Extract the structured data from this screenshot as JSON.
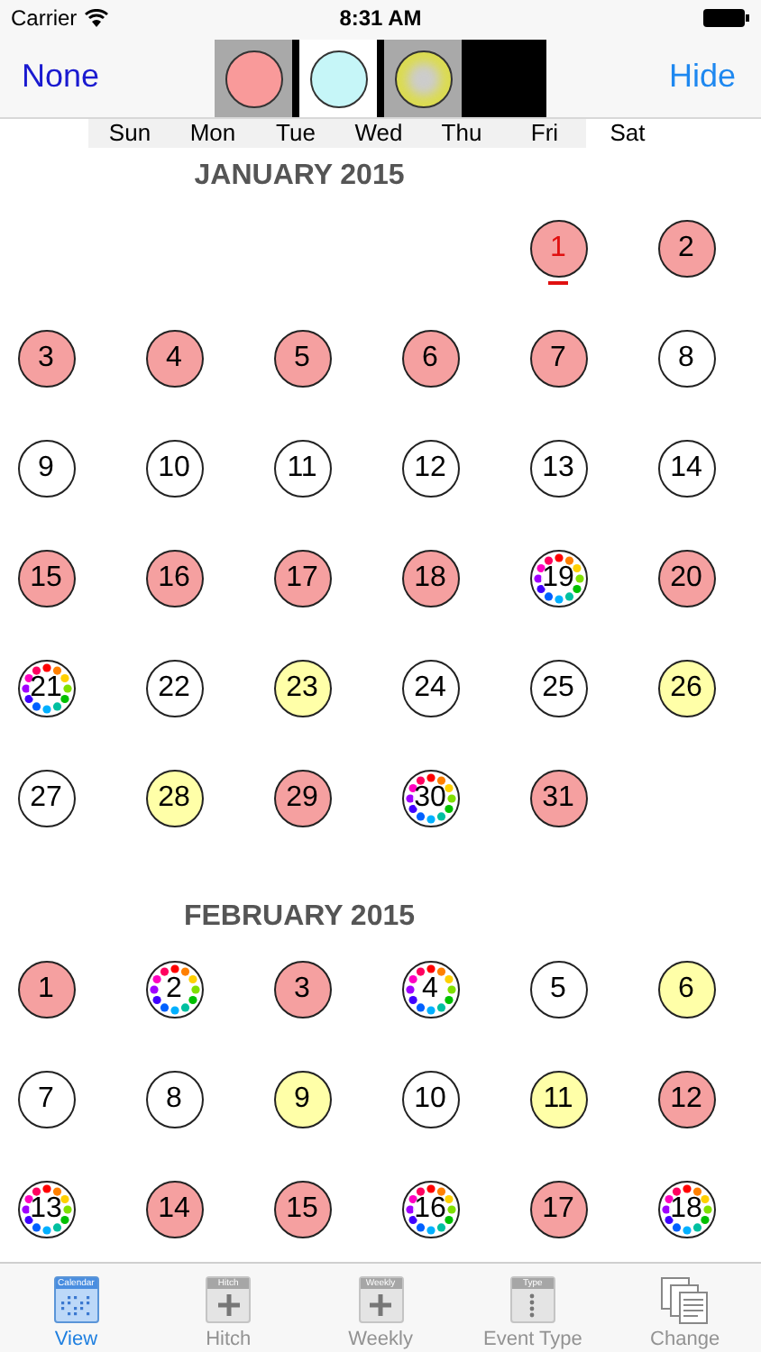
{
  "status_bar": {
    "carrier": "Carrier",
    "time": "8:31 AM"
  },
  "nav_bar": {
    "left_button": "None",
    "right_button": "Hide"
  },
  "swatches": [
    {
      "kind": "circle",
      "color": "#f99a9a",
      "selected": true
    },
    {
      "kind": "circle",
      "color": "#c6f6f8",
      "selected": false
    },
    {
      "kind": "gradient",
      "color": "#dcdc50",
      "selected": true
    },
    {
      "kind": "empty",
      "color": "#000000"
    }
  ],
  "weekdays": [
    {
      "label": "Sun",
      "shaded": true
    },
    {
      "label": "Mon",
      "shaded": true
    },
    {
      "label": "Tue",
      "shaded": true
    },
    {
      "label": "Wed",
      "shaded": true
    },
    {
      "label": "Thu",
      "shaded": true
    },
    {
      "label": "Fri",
      "shaded": true
    },
    {
      "label": "Sat",
      "shaded": false
    }
  ],
  "months": [
    {
      "title": "JANUARY 2015",
      "days": [
        {
          "label": "1",
          "kind": "filled",
          "color": "#f5a0a0",
          "today": true
        },
        {
          "label": "2",
          "kind": "filled",
          "color": "#f5a0a0",
          "today": false
        },
        {
          "label": "3",
          "kind": "filled",
          "color": "#f5a0a0",
          "today": false
        },
        {
          "label": "4",
          "kind": "filled",
          "color": "#f5a0a0",
          "today": false
        },
        {
          "label": "5",
          "kind": "filled",
          "color": "#f5a0a0",
          "today": false
        },
        {
          "label": "6",
          "kind": "filled",
          "color": "#f5a0a0",
          "today": false
        },
        {
          "label": "7",
          "kind": "filled",
          "color": "#f5a0a0",
          "today": false
        },
        {
          "label": "8",
          "kind": "plain",
          "today": false
        },
        {
          "label": "9",
          "kind": "plain",
          "today": false
        },
        {
          "label": "10",
          "kind": "plain",
          "today": false
        },
        {
          "label": "11",
          "kind": "plain",
          "today": false
        },
        {
          "label": "12",
          "kind": "plain",
          "today": false
        },
        {
          "label": "13",
          "kind": "plain",
          "today": false
        },
        {
          "label": "14",
          "kind": "plain",
          "today": false
        },
        {
          "label": "15",
          "kind": "filled",
          "color": "#f5a0a0",
          "today": false
        },
        {
          "label": "16",
          "kind": "filled",
          "color": "#f5a0a0",
          "today": false
        },
        {
          "label": "17",
          "kind": "filled",
          "color": "#f5a0a0",
          "today": false
        },
        {
          "label": "18",
          "kind": "filled",
          "color": "#f5a0a0",
          "today": false
        },
        {
          "label": "19",
          "kind": "multi",
          "today": false
        },
        {
          "label": "20",
          "kind": "filled",
          "color": "#f5a0a0",
          "today": false
        },
        {
          "label": "21",
          "kind": "multi",
          "today": false
        },
        {
          "label": "22",
          "kind": "plain",
          "today": false
        },
        {
          "label": "23",
          "kind": "filled",
          "color": "#ffffa8",
          "today": false
        },
        {
          "label": "24",
          "kind": "plain",
          "today": false
        },
        {
          "label": "25",
          "kind": "plain",
          "today": false
        },
        {
          "label": "26",
          "kind": "filled",
          "color": "#ffffa8",
          "today": false
        },
        {
          "label": "27",
          "kind": "plain",
          "today": false
        },
        {
          "label": "28",
          "kind": "filled",
          "color": "#ffffa8",
          "today": false
        },
        {
          "label": "29",
          "kind": "filled",
          "color": "#f5a0a0",
          "today": false
        },
        {
          "label": "30",
          "kind": "multi",
          "today": false
        },
        {
          "label": "31",
          "kind": "filled",
          "color": "#f5a0a0",
          "today": false
        }
      ]
    },
    {
      "title": "FEBRUARY 2015",
      "days": [
        {
          "label": "1",
          "kind": "filled",
          "color": "#f5a0a0",
          "today": false
        },
        {
          "label": "2",
          "kind": "multi",
          "today": false
        },
        {
          "label": "3",
          "kind": "filled",
          "color": "#f5a0a0",
          "today": false
        },
        {
          "label": "4",
          "kind": "multi",
          "today": false
        },
        {
          "label": "5",
          "kind": "plain",
          "today": false
        },
        {
          "label": "6",
          "kind": "filled",
          "color": "#ffffa8",
          "today": false
        },
        {
          "label": "7",
          "kind": "plain",
          "today": false
        },
        {
          "label": "8",
          "kind": "plain",
          "today": false
        },
        {
          "label": "9",
          "kind": "filled",
          "color": "#ffffa8",
          "today": false
        },
        {
          "label": "10",
          "kind": "plain",
          "today": false
        },
        {
          "label": "11",
          "kind": "filled",
          "color": "#ffffa8",
          "today": false
        },
        {
          "label": "12",
          "kind": "filled",
          "color": "#f5a0a0",
          "today": false
        },
        {
          "label": "13",
          "kind": "multi",
          "today": false
        },
        {
          "label": "14",
          "kind": "filled",
          "color": "#f5a0a0",
          "today": false
        },
        {
          "label": "15",
          "kind": "filled",
          "color": "#f5a0a0",
          "today": false
        },
        {
          "label": "16",
          "kind": "multi",
          "today": false
        },
        {
          "label": "17",
          "kind": "filled",
          "color": "#f5a0a0",
          "today": false
        },
        {
          "label": "18",
          "kind": "multi",
          "today": false
        }
      ]
    }
  ],
  "tab_bar": [
    {
      "label": "View",
      "icon_caption": "Calendar",
      "kind": "calendar",
      "selected": true
    },
    {
      "label": "Hitch",
      "icon_caption": "Hitch",
      "kind": "plus",
      "selected": false
    },
    {
      "label": "Weekly",
      "icon_caption": "Weekly",
      "kind": "plus",
      "selected": false
    },
    {
      "label": "Event Type",
      "icon_caption": "Type",
      "kind": "dots",
      "selected": false
    },
    {
      "label": "Change",
      "kind": "pages",
      "selected": false
    }
  ]
}
